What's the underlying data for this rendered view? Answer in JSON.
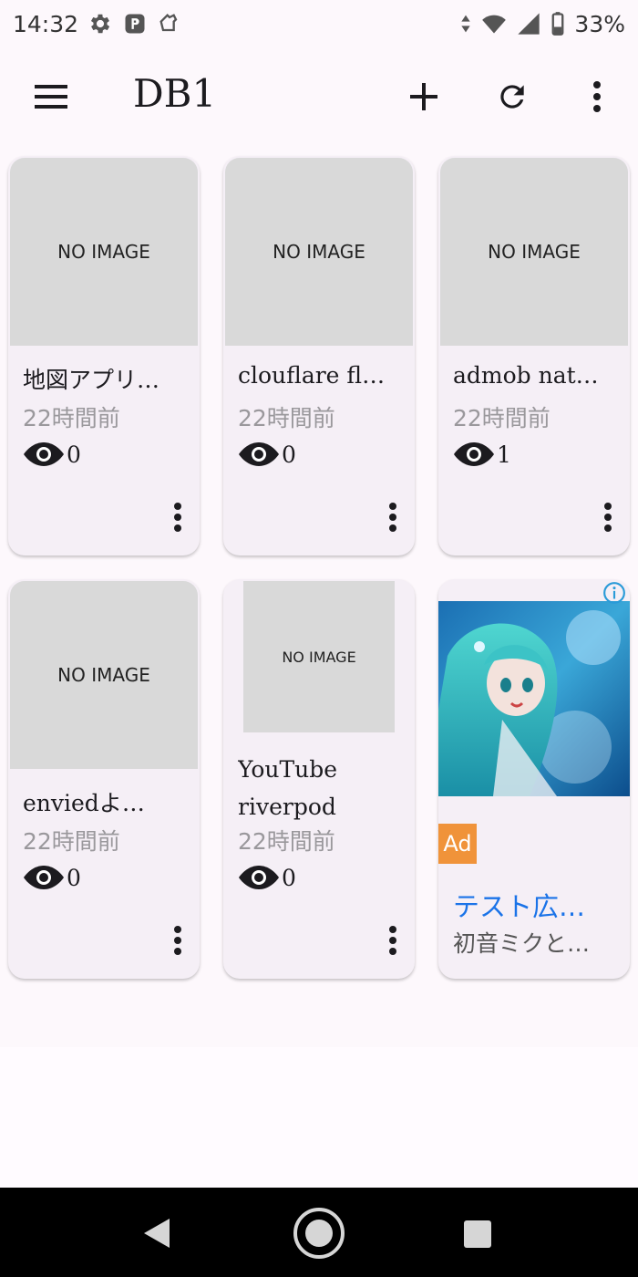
{
  "status_bar": {
    "time": "14:32",
    "battery": "33%"
  },
  "app_bar": {
    "title": "DB1"
  },
  "cards": [
    {
      "thumb": "NO IMAGE",
      "title": "地図アプリ…",
      "time": "22時間前",
      "views": "0"
    },
    {
      "thumb": "NO IMAGE",
      "title": "clouflare fl…",
      "time": "22時間前",
      "views": "0"
    },
    {
      "thumb": "NO IMAGE",
      "title": "admob nat…",
      "time": "22時間前",
      "views": "1"
    },
    {
      "thumb": "NO IMAGE",
      "title": "enviedよ…",
      "time": "22時間前",
      "views": "0"
    },
    {
      "thumb": "NO IMAGE",
      "title_line1": "YouTube",
      "title_line2": "riverpod",
      "time": "22時間前",
      "views": "0"
    }
  ],
  "ad": {
    "badge": "Ad",
    "headline": "テスト広…",
    "body": "初音ミクと…"
  },
  "colors": {
    "background": "#fdf8fc",
    "card": "#f5eff6",
    "thumb": "#d9d9d9",
    "ad_badge": "#f0933a",
    "ad_headline": "#1a73e8",
    "muted_text": "#9a989c"
  },
  "icons": [
    "settings-icon",
    "pocket-icon",
    "app-notification-icon",
    "data-arrows-icon",
    "wifi-icon",
    "signal-icon",
    "battery-icon",
    "menu-icon",
    "add-icon",
    "refresh-icon",
    "more-vert-icon",
    "eye-icon",
    "info-icon",
    "back-icon",
    "home-icon",
    "recents-icon"
  ]
}
